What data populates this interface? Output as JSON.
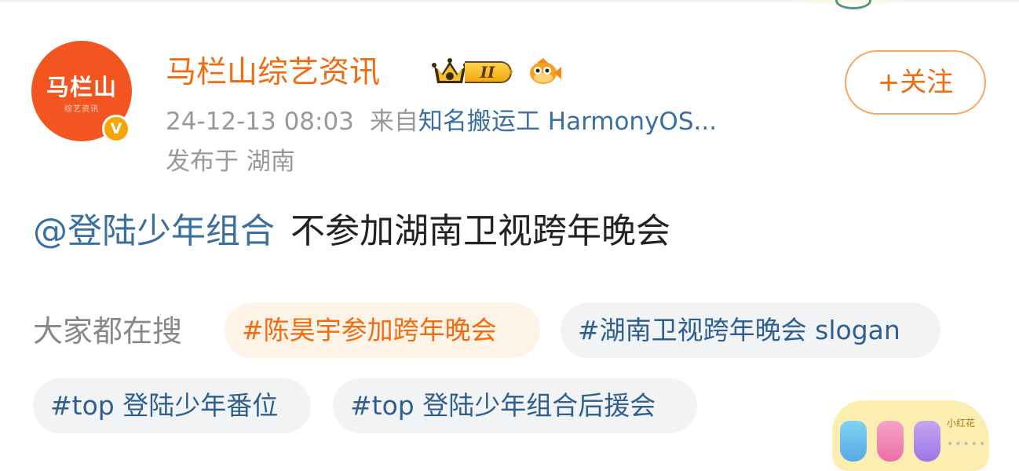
{
  "post": {
    "author": {
      "avatar_text": "马栏山",
      "avatar_subtext": "综艺资讯",
      "verified_mark": "V",
      "name": "马栏山综艺资讯",
      "level": "II"
    },
    "time": "24-12-13 08:03",
    "from_prefix": "来自",
    "source": "知名搬运工 HarmonyOS...",
    "location": "发布于 湖南",
    "follow_label": "+关注",
    "mention": "@登陆少年组合",
    "text": "不参加湖南卫视跨年晚会"
  },
  "search": {
    "label": "大家都在搜",
    "tags": [
      {
        "text": "#陈昊宇参加跨年晚会",
        "style": "hot"
      },
      {
        "text": "#湖南卫视跨年晚会 slogan",
        "style": "normal"
      },
      {
        "text": "#top 登陆少年番位",
        "style": "normal"
      },
      {
        "text": "#top 登陆少年组合后援会",
        "style": "normal"
      }
    ]
  },
  "decorations": {
    "sticker_label": "小红花",
    "more_dots": "•••••"
  },
  "colors": {
    "username": "#f06b12",
    "link": "#3a6fa0",
    "muted": "#999999",
    "hot_tag_bg": "#fdf3e7",
    "tag_bg": "#f1f3f5",
    "avatar_bg": "#f2551f"
  },
  "icons": [
    "crown-icon",
    "level-badge",
    "fish-icon",
    "verified-badge-icon"
  ]
}
